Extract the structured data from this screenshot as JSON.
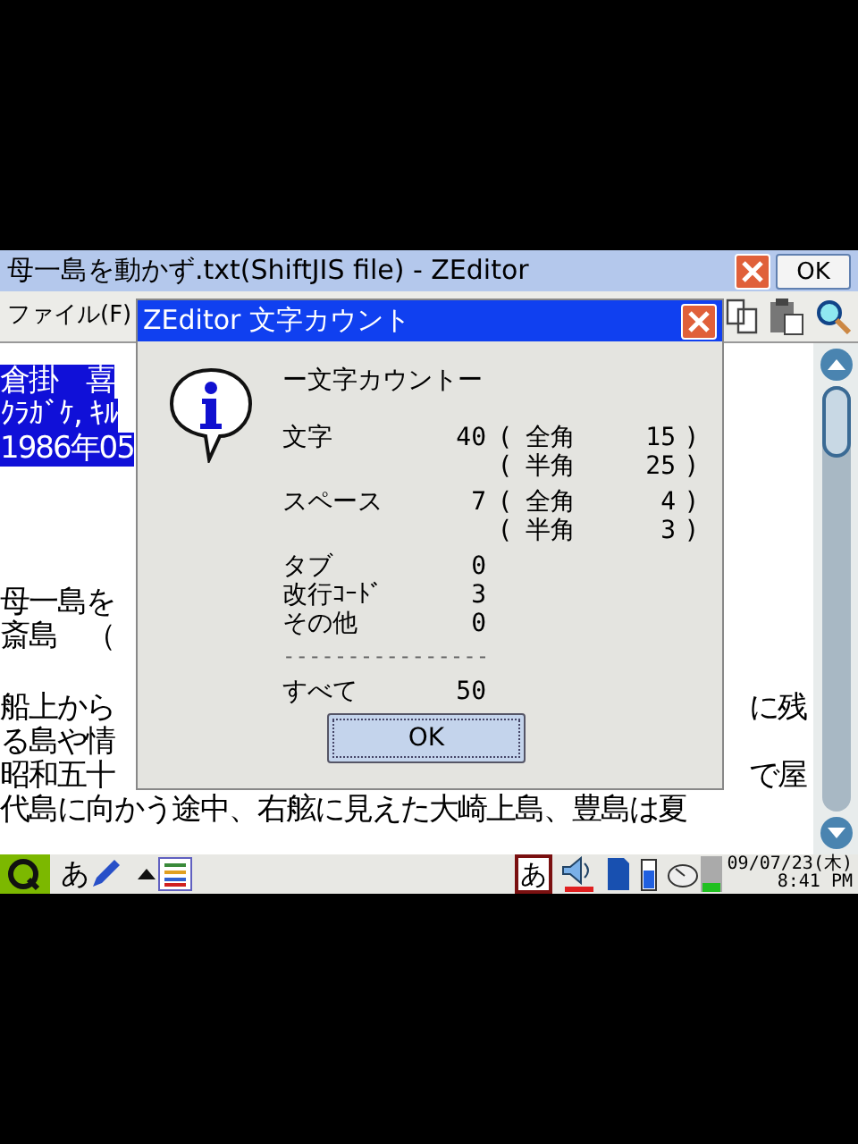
{
  "window": {
    "title": "母一島を動かず.txt(ShiftJIS file) - ZEditor",
    "ok_button": "OK"
  },
  "menu": [
    {
      "label": "ファイル(F)"
    }
  ],
  "document": {
    "blocks": [
      {
        "lines": [
          {
            "left": "倉掛　喜",
            "selected": true
          },
          {
            "left": "ｸﾗｶﾞｹ, ｷﾙ",
            "selected": true
          },
          {
            "left": "1986年05",
            "selected": true
          }
        ]
      },
      {
        "lines": [
          {
            "left": "母一島を",
            "selected": false
          },
          {
            "left": "斎島　（",
            "selected": false
          }
        ]
      },
      {
        "lines": [
          {
            "left": "船上から",
            "right": "に残",
            "selected": false
          },
          {
            "left": "る島や情",
            "selected": false
          },
          {
            "left": "昭和五十",
            "right": "で屋",
            "selected": false
          },
          {
            "left": "代島に向かう途中、右舷に見えた大崎上島、豊島は夏",
            "selected": false
          }
        ]
      }
    ]
  },
  "dialog": {
    "title": "ZEditor 文字カウント",
    "heading": "ー文字カウントー",
    "rows": [
      {
        "label": "文字",
        "value": "40",
        "breakdown": [
          {
            "open": "(",
            "label": "全角",
            "count": "15",
            "close": ")"
          },
          {
            "open": "(",
            "label": "半角",
            "count": "25",
            "close": ")"
          }
        ]
      },
      {
        "label": "スペース",
        "value": "7",
        "breakdown": [
          {
            "open": "(",
            "label": "全角",
            "count": "4",
            "close": ")"
          },
          {
            "open": "(",
            "label": "半角",
            "count": "3",
            "close": ")"
          }
        ]
      },
      {
        "label": "タブ",
        "value": "0"
      },
      {
        "label": "改行ｺｰﾄﾞ",
        "value": "3"
      },
      {
        "label": "その他",
        "value": "0"
      }
    ],
    "separator": "----------------",
    "total": {
      "label": "すべて",
      "value": "50"
    },
    "ok_button": "OK"
  },
  "taskbar": {
    "input_mode": "あ",
    "ime": "あ",
    "date": "09/07/23(木)",
    "time": "8:41 PM"
  }
}
